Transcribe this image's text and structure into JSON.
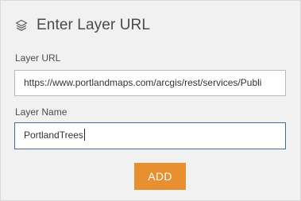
{
  "dialog": {
    "title": "Enter Layer URL",
    "icon": "layers-icon"
  },
  "layer_url": {
    "label": "Layer URL",
    "value": "https://www.portlandmaps.com/arcgis/rest/services/Publi"
  },
  "layer_name": {
    "label": "Layer Name",
    "value": "PortlandTrees"
  },
  "actions": {
    "add_label": "ADD"
  },
  "colors": {
    "panel_background": "#f1f1f1",
    "accent_button": "#e8902f",
    "focused_border": "#3f6f96"
  }
}
